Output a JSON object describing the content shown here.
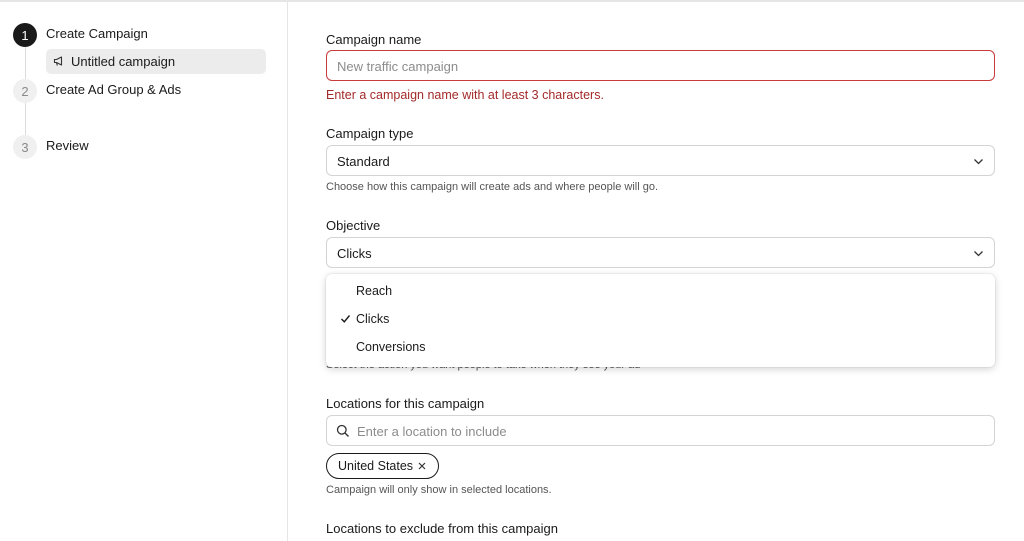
{
  "sidebar": {
    "steps": [
      {
        "number": "1",
        "label": "Create Campaign"
      },
      {
        "number": "2",
        "label": "Create Ad Group & Ads"
      },
      {
        "number": "3",
        "label": "Review"
      }
    ],
    "sub_item": {
      "label": "Untitled campaign",
      "icon": "megaphone-icon"
    }
  },
  "form": {
    "campaign_name": {
      "label": "Campaign name",
      "placeholder": "New traffic campaign",
      "error": "Enter a campaign name with at least 3 characters."
    },
    "campaign_type": {
      "label": "Campaign type",
      "value": "Standard",
      "help": "Choose how this campaign will create ads and where people will go."
    },
    "objective": {
      "label": "Objective",
      "value": "Clicks",
      "help_obscured": "Select the action you want people to take when they see your ad",
      "options": [
        "Reach",
        "Clicks",
        "Conversions"
      ],
      "selected": "Clicks"
    },
    "locations": {
      "label": "Locations for this campaign",
      "placeholder": "Enter a location to include",
      "chip": "United States",
      "help": "Campaign will only show in selected locations."
    },
    "exclude_locations": {
      "label": "Locations to exclude from this campaign"
    }
  },
  "colors": {
    "error": "#c93a3a",
    "active_step": "#1a1a1a",
    "sub_item_bg": "#ececec"
  }
}
